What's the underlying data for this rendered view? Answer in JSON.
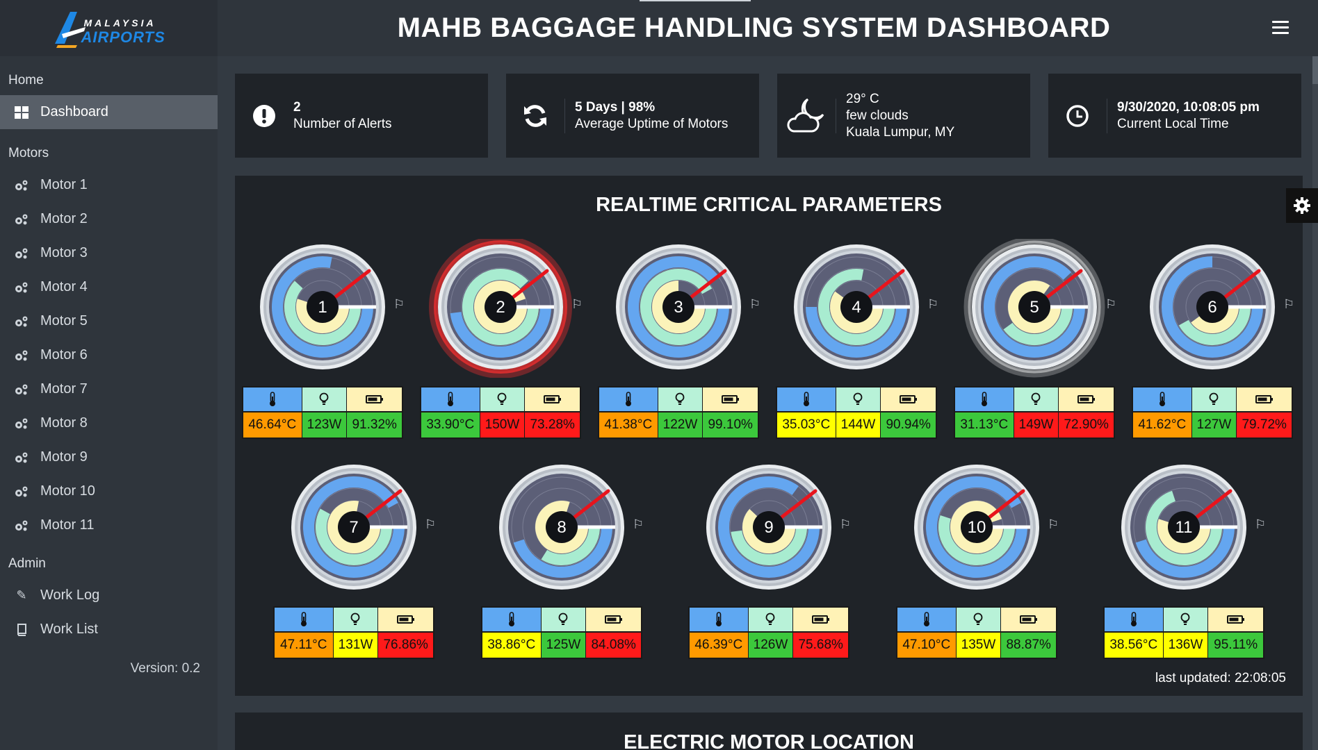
{
  "header": {
    "title": "MAHB BAGGAGE HANDLING SYSTEM DASHBOARD"
  },
  "logo": {
    "top": "MALAYSIA",
    "bottom": "AIRPORTS"
  },
  "sidebar": {
    "home": "Home",
    "dashboard": "Dashboard",
    "motors_heading": "Motors",
    "motors": [
      "Motor 1",
      "Motor 2",
      "Motor 3",
      "Motor 4",
      "Motor 5",
      "Motor 6",
      "Motor 7",
      "Motor 8",
      "Motor 9",
      "Motor 10",
      "Motor 11"
    ],
    "admin_heading": "Admin",
    "work_log": "Work Log",
    "work_list": "Work List",
    "version": "Version: 0.2"
  },
  "cards": {
    "alerts": {
      "value": "2",
      "label": "Number of Alerts",
      "icon": "exclamation-circle-icon"
    },
    "uptime": {
      "value": "5 Days | 98%",
      "label": "Average Uptime of Motors",
      "icon": "refresh-icon"
    },
    "weather": {
      "temp": "29° C",
      "desc": "few clouds",
      "location": "Kuala Lumpur, MY",
      "icon": "cloud-moon-icon"
    },
    "time": {
      "value": "9/30/2020, 10:08:05 pm",
      "label": "Current Local Time",
      "icon": "clock-icon"
    }
  },
  "panel": {
    "title": "REALTIME CRITICAL PARAMETERS",
    "last_updated": "last updated: 22:08:05"
  },
  "colors": {
    "temp_ring": "#64a6f0",
    "power_ring": "#a8ecd0",
    "battery_ring": "#fbf3b9",
    "orange": "#ff9a00",
    "green": "#3cc83c",
    "red": "#ff1a1a",
    "yellow": "#ffff00",
    "alert_glow": "#ff3030"
  },
  "motors": [
    {
      "id": "1",
      "temp": "46.64°C",
      "power": "123W",
      "battery": "91.32%",
      "temp_color": "orange",
      "power_color": "green",
      "battery_color": "green",
      "temp_frac": 0.78,
      "power_frac": 0.62,
      "battery_frac": 0.55,
      "glow": "none"
    },
    {
      "id": "2",
      "temp": "33.90°C",
      "power": "150W",
      "battery": "73.28%",
      "temp_color": "green",
      "power_color": "red",
      "battery_color": "red",
      "temp_frac": 0.48,
      "power_frac": 0.88,
      "battery_frac": 0.95,
      "glow": "red"
    },
    {
      "id": "3",
      "temp": "41.38°C",
      "power": "122W",
      "battery": "99.10%",
      "temp_color": "orange",
      "power_color": "green",
      "battery_color": "green",
      "temp_frac": 0.9,
      "power_frac": 0.92,
      "battery_frac": 0.75,
      "glow": "none"
    },
    {
      "id": "4",
      "temp": "35.03°C",
      "power": "144W",
      "battery": "90.94%",
      "temp_color": "yellow",
      "power_color": "yellow",
      "battery_color": "green",
      "temp_frac": 0.5,
      "power_frac": 0.78,
      "battery_frac": 0.6,
      "glow": "none"
    },
    {
      "id": "5",
      "temp": "31.13°C",
      "power": "149W",
      "battery": "72.90%",
      "temp_color": "green",
      "power_color": "red",
      "battery_color": "red",
      "temp_frac": 0.88,
      "power_frac": 0.4,
      "battery_frac": 0.85,
      "glow": "white"
    },
    {
      "id": "6",
      "temp": "41.62°C",
      "power": "127W",
      "battery": "79.72%",
      "temp_color": "orange",
      "power_color": "green",
      "battery_color": "red",
      "temp_frac": 0.75,
      "power_frac": 0.42,
      "battery_frac": 0.4,
      "glow": "none"
    },
    {
      "id": "7",
      "temp": "47.11°C",
      "power": "131W",
      "battery": "76.86%",
      "temp_color": "orange",
      "power_color": "yellow",
      "battery_color": "red",
      "temp_frac": 0.92,
      "power_frac": 0.58,
      "battery_frac": 0.78,
      "glow": "none"
    },
    {
      "id": "8",
      "temp": "38.86°C",
      "power": "125W",
      "battery": "84.08%",
      "temp_color": "yellow",
      "power_color": "green",
      "battery_color": "red",
      "temp_frac": 0.45,
      "power_frac": 0.34,
      "battery_frac": 0.8,
      "glow": "none"
    },
    {
      "id": "9",
      "temp": "46.39°C",
      "power": "126W",
      "battery": "75.68%",
      "temp_color": "orange",
      "power_color": "green",
      "battery_color": "red",
      "temp_frac": 0.85,
      "power_frac": 0.48,
      "battery_frac": 0.62,
      "glow": "none"
    },
    {
      "id": "10",
      "temp": "47.10°C",
      "power": "135W",
      "battery": "88.87%",
      "temp_color": "orange",
      "power_color": "yellow",
      "battery_color": "green",
      "temp_frac": 0.92,
      "power_frac": 0.55,
      "battery_frac": 0.95,
      "glow": "none"
    },
    {
      "id": "11",
      "temp": "38.56°C",
      "power": "136W",
      "battery": "95.11%",
      "temp_color": "yellow",
      "power_color": "yellow",
      "battery_color": "green",
      "temp_frac": 0.45,
      "power_frac": 0.7,
      "battery_frac": 0.55,
      "glow": "none"
    }
  ],
  "panel2": {
    "title": "ELECTRIC MOTOR LOCATION"
  }
}
